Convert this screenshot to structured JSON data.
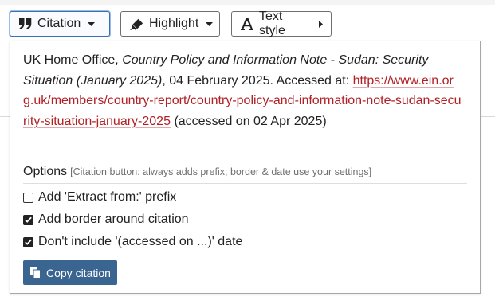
{
  "toolbar": {
    "citation_label": "Citation",
    "highlight_label": "Highlight",
    "textstyle_label": "Text style"
  },
  "citation": {
    "author": "UK Home Office,",
    "title": "Country Policy and Information Note - Sudan: Security Situation (January 2025)",
    "date_sep": ", 04 February 2025. Accessed at:",
    "url": "https://www.ein.org.uk/members/country-report/country-policy-and-information-note-sudan-security-situation-january-2025",
    "accessed": "(accessed on 02 Apr 2025)"
  },
  "options": {
    "heading": "Options",
    "hint": "[Citation button: always adds prefix; border & date use your settings]",
    "items": [
      {
        "label": "Add 'Extract from:' prefix",
        "checked": false
      },
      {
        "label": "Add border around citation",
        "checked": true
      },
      {
        "label": "Don't include '(accessed on ...)' date",
        "checked": true
      }
    ]
  },
  "copy_button": {
    "label": "Copy citation"
  },
  "colors": {
    "link": "#b02025",
    "primary_button": "#3b6591",
    "active_border": "#3a6fb3"
  },
  "icons": [
    "quote-icon",
    "caret-down-icon",
    "highlighter-icon",
    "text-style-icon",
    "caret-right-icon",
    "checkmark-icon",
    "copy-icon"
  ]
}
